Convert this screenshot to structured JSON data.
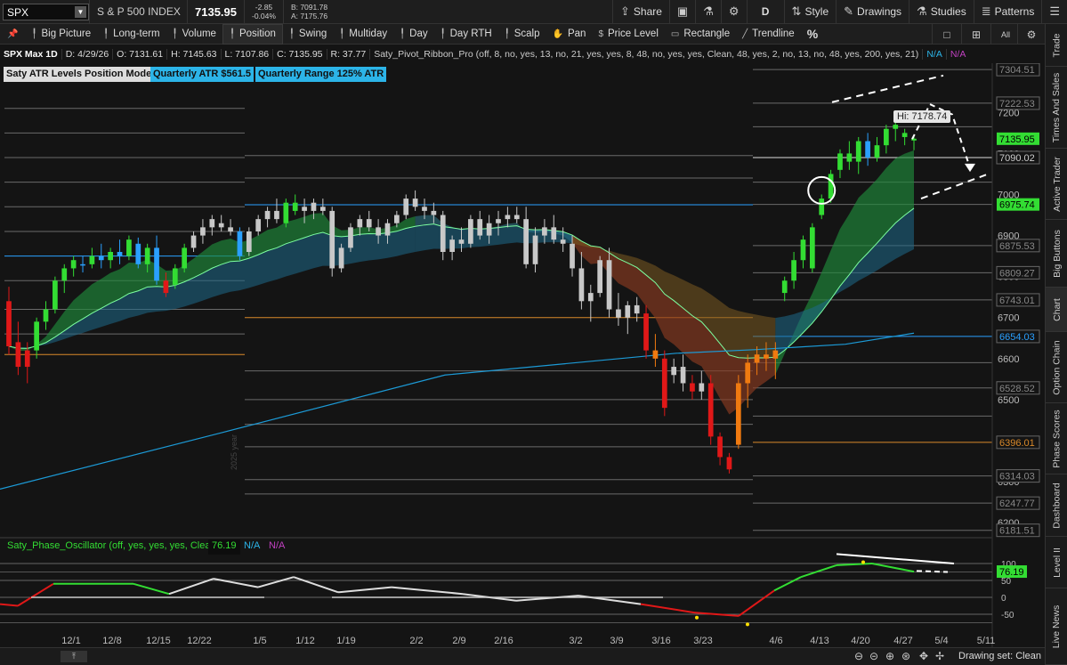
{
  "topbar": {
    "symbol": "SPX",
    "description": "S & P 500 INDEX",
    "last_price": "7135.95",
    "change": "-2.85",
    "change_pct": "-0.04%",
    "bid": "B: 7091.78",
    "ask": "A: 7175.76",
    "share": "Share",
    "aggregation": "D",
    "style": "Style",
    "drawings": "Drawings",
    "studies": "Studies",
    "patterns": "Patterns"
  },
  "toolbar": {
    "items": [
      "Big Picture",
      "Long-term",
      "Volume",
      "Position",
      "Swing",
      "Multiday",
      "Day",
      "Day RTH",
      "Scalp",
      "Pan",
      "Price Level",
      "Rectangle",
      "Trendline"
    ],
    "active": "Position",
    "percent": "%",
    "all_label": "All"
  },
  "infobar": {
    "title": "SPX Max 1D",
    "date": "D: 4/29/26",
    "open": "O: 7131.61",
    "high": "H: 7145.63",
    "low": "L: 7107.86",
    "close": "C: 7135.95",
    "range": "R: 37.77",
    "study": "Saty_Pivot_Ribbon_Pro (off, 8, no, yes, 13, no, 21, yes, yes, 8, 48, no, yes, yes, Clean, 48, yes, 2, no, 13, no, 48, yes, 200, yes, 21)",
    "na1": "N/A",
    "na2": "N/A"
  },
  "badges": {
    "atr_mode": "Saty ATR Levels Position Mode",
    "quarterly_atr": "Quarterly ATR $561.5",
    "quarterly_range": "Quarterly Range 125% ATR"
  },
  "annotations": {
    "hi_label": "Hi: 7178.74",
    "year_watermark": "2025 year"
  },
  "oscillator": {
    "name": "Saty_Phase_Oscillator (off, yes, yes, yes, Clean)",
    "value": "76.19",
    "na1": "N/A",
    "na2": "N/A"
  },
  "sidebar": {
    "tabs": [
      "Trade",
      "Times And Sales",
      "Active Trader",
      "Big Buttons",
      "Chart",
      "Option Chain",
      "Phase Scores",
      "Dashboard",
      "Level II",
      "Live News"
    ]
  },
  "bottombar": {
    "drawing_set": "Drawing set: Clean"
  },
  "colors": {
    "background": "#141414",
    "bull_green": "#33dd33",
    "bull_cyan": "#2aa0ff",
    "bear_red": "#e01818",
    "neutral_gray": "#c8c8c8",
    "ema_blue": "#1c9ad6",
    "atr_orange": "#d9892a",
    "badge_cyan": "#2cb4e8"
  },
  "chart_data": {
    "type": "candlestick",
    "y_axis_labels": [
      "7200",
      "7100",
      "7000",
      "6900",
      "6800",
      "6700",
      "6600",
      "6500",
      "6400",
      "6300",
      "6200"
    ],
    "x_axis_labels": [
      "12/1",
      "12/8",
      "12/15",
      "12/22",
      "1/5",
      "1/12",
      "1/19",
      "2/2",
      "2/9",
      "2/16",
      "3/2",
      "3/9",
      "3/16",
      "3/23",
      "4/6",
      "4/13",
      "4/20",
      "4/27",
      "5/4",
      "5/11"
    ],
    "ylim": [
      6170,
      7320
    ],
    "price_tags": [
      {
        "label": "7304.51",
        "value": 7304.51,
        "color": "#888888"
      },
      {
        "label": "7222.53",
        "value": 7222.53,
        "color": "#888888"
      },
      {
        "label": "7135.95",
        "value": 7135.95,
        "color": "#33dd33"
      },
      {
        "label": "7090.02",
        "value": 7090.02,
        "color": "#cccccc"
      },
      {
        "label": "6975.74",
        "value": 6975.74,
        "color": "#33dd33"
      },
      {
        "label": "6875.53",
        "value": 6875.53,
        "color": "#888888"
      },
      {
        "label": "6809.27",
        "value": 6809.27,
        "color": "#888888"
      },
      {
        "label": "6743.01",
        "value": 6743.01,
        "color": "#888888"
      },
      {
        "label": "6654.03",
        "value": 6654.03,
        "color": "#2aa0ff"
      },
      {
        "label": "6528.52",
        "value": 6528.52,
        "color": "#888888"
      },
      {
        "label": "6396.01",
        "value": 6396.01,
        "color": "#d9892a"
      },
      {
        "label": "6314.03",
        "value": 6314.03,
        "color": "#888888"
      },
      {
        "label": "6247.77",
        "value": 6247.77,
        "color": "#888888"
      },
      {
        "label": "6181.51",
        "value": 6181.51,
        "color": "#888888"
      }
    ],
    "candles": [
      [
        6740,
        6775,
        6610,
        6630,
        "red"
      ],
      [
        6640,
        6690,
        6560,
        6580,
        "red"
      ],
      [
        6580,
        6640,
        6540,
        6620,
        "red"
      ],
      [
        6620,
        6700,
        6600,
        6690,
        "green"
      ],
      [
        6690,
        6740,
        6670,
        6720,
        "green"
      ],
      [
        6720,
        6800,
        6710,
        6790,
        "green"
      ],
      [
        6790,
        6830,
        6760,
        6820,
        "green"
      ],
      [
        6820,
        6850,
        6800,
        6840,
        "green"
      ],
      [
        6830,
        6850,
        6810,
        6830,
        "cyan"
      ],
      [
        6830,
        6870,
        6820,
        6850,
        "green"
      ],
      [
        6850,
        6880,
        6820,
        6840,
        "cyan"
      ],
      [
        6840,
        6870,
        6820,
        6860,
        "green"
      ],
      [
        6860,
        6890,
        6830,
        6850,
        "cyan"
      ],
      [
        6850,
        6900,
        6840,
        6890,
        "green"
      ],
      [
        6880,
        6895,
        6820,
        6830,
        "cyan"
      ],
      [
        6830,
        6880,
        6810,
        6870,
        "green"
      ],
      [
        6870,
        6900,
        6780,
        6790,
        "cyan"
      ],
      [
        6790,
        6810,
        6750,
        6760,
        "red"
      ],
      [
        6780,
        6830,
        6770,
        6820,
        "green"
      ],
      [
        6820,
        6880,
        6810,
        6870,
        "green"
      ],
      [
        6870,
        6910,
        6860,
        6900,
        "gray"
      ],
      [
        6900,
        6940,
        6880,
        6920,
        "gray"
      ],
      [
        6920,
        6950,
        6900,
        6940,
        "gray"
      ],
      [
        6930,
        6950,
        6910,
        6920,
        "gray"
      ],
      [
        6920,
        6940,
        6900,
        6910,
        "gray"
      ],
      [
        6910,
        6920,
        6840,
        6850,
        "cyan"
      ],
      [
        6860,
        6920,
        6850,
        6910,
        "gray"
      ],
      [
        6910,
        6950,
        6900,
        6940,
        "gray"
      ],
      [
        6940,
        6970,
        6920,
        6960,
        "gray"
      ],
      [
        6960,
        6990,
        6930,
        6940,
        "gray"
      ],
      [
        6930,
        6990,
        6920,
        6980,
        "green"
      ],
      [
        6980,
        7000,
        6950,
        6960,
        "green"
      ],
      [
        6960,
        6990,
        6930,
        6970,
        "gray"
      ],
      [
        6960,
        6990,
        6940,
        6980,
        "gray"
      ],
      [
        6970,
        6990,
        6950,
        6960,
        "gray"
      ],
      [
        6960,
        6970,
        6800,
        6820,
        "gray"
      ],
      [
        6820,
        6880,
        6810,
        6870,
        "gray"
      ],
      [
        6870,
        6930,
        6860,
        6920,
        "gray"
      ],
      [
        6920,
        6950,
        6900,
        6940,
        "gray"
      ],
      [
        6940,
        6960,
        6910,
        6920,
        "gray"
      ],
      [
        6920,
        6940,
        6880,
        6900,
        "gray"
      ],
      [
        6900,
        6940,
        6880,
        6930,
        "gray"
      ],
      [
        6930,
        6960,
        6920,
        6950,
        "gray"
      ],
      [
        6950,
        7000,
        6940,
        6990,
        "gray"
      ],
      [
        6990,
        7010,
        6960,
        6970,
        "gray"
      ],
      [
        6970,
        6990,
        6940,
        6960,
        "gray"
      ],
      [
        6960,
        6980,
        6930,
        6950,
        "gray"
      ],
      [
        6950,
        6960,
        6840,
        6860,
        "gray"
      ],
      [
        6860,
        6900,
        6840,
        6890,
        "gray"
      ],
      [
        6890,
        6920,
        6860,
        6880,
        "gray"
      ],
      [
        6880,
        6950,
        6870,
        6940,
        "gray"
      ],
      [
        6940,
        6960,
        6890,
        6900,
        "gray"
      ],
      [
        6900,
        6950,
        6880,
        6930,
        "gray"
      ],
      [
        6930,
        6960,
        6900,
        6940,
        "gray"
      ],
      [
        6940,
        6970,
        6920,
        6950,
        "gray"
      ],
      [
        6950,
        6970,
        6930,
        6940,
        "gray"
      ],
      [
        6940,
        6970,
        6820,
        6830,
        "gray"
      ],
      [
        6830,
        6920,
        6810,
        6900,
        "gray"
      ],
      [
        6900,
        6940,
        6880,
        6920,
        "gray"
      ],
      [
        6920,
        6950,
        6880,
        6890,
        "gray"
      ],
      [
        6890,
        6920,
        6860,
        6880,
        "gray"
      ],
      [
        6880,
        6900,
        6800,
        6820,
        "gray"
      ],
      [
        6820,
        6860,
        6720,
        6740,
        "gray"
      ],
      [
        6740,
        6780,
        6690,
        6760,
        "gray"
      ],
      [
        6760,
        6850,
        6750,
        6840,
        "gray"
      ],
      [
        6840,
        6870,
        6700,
        6720,
        "gray"
      ],
      [
        6720,
        6760,
        6680,
        6700,
        "gray"
      ],
      [
        6700,
        6740,
        6660,
        6730,
        "gray"
      ],
      [
        6730,
        6750,
        6690,
        6710,
        "gray"
      ],
      [
        6710,
        6730,
        6600,
        6620,
        "red"
      ],
      [
        6620,
        6660,
        6580,
        6600,
        "orange"
      ],
      [
        6600,
        6620,
        6460,
        6480,
        "red"
      ],
      [
        6560,
        6600,
        6540,
        6580,
        "gray"
      ],
      [
        6580,
        6610,
        6520,
        6540,
        "gray"
      ],
      [
        6540,
        6560,
        6500,
        6520,
        "red"
      ],
      [
        6520,
        6570,
        6500,
        6540,
        "gray"
      ],
      [
        6540,
        6560,
        6390,
        6410,
        "red"
      ],
      [
        6410,
        6420,
        6340,
        6360,
        "red"
      ],
      [
        6360,
        6370,
        6320,
        6330,
        "red"
      ],
      [
        6390,
        6560,
        6380,
        6540,
        "orange"
      ],
      [
        6540,
        6610,
        6480,
        6590,
        "orange"
      ],
      [
        6590,
        6630,
        6560,
        6610,
        "orange"
      ],
      [
        6610,
        6640,
        6570,
        6600,
        "orange"
      ],
      [
        6600,
        6640,
        6550,
        6620,
        "orange"
      ],
      [
        6760,
        6800,
        6740,
        6790,
        "green"
      ],
      [
        6790,
        6860,
        6770,
        6840,
        "green"
      ],
      [
        6840,
        6900,
        6820,
        6890,
        "green"
      ],
      [
        6820,
        6930,
        6810,
        6920,
        "green"
      ],
      [
        6950,
        7000,
        6940,
        6990,
        "green"
      ],
      [
        6990,
        7060,
        6980,
        7050,
        "green"
      ],
      [
        7060,
        7110,
        7040,
        7100,
        "green"
      ],
      [
        7100,
        7130,
        7060,
        7080,
        "green"
      ],
      [
        7080,
        7140,
        7050,
        7130,
        "green"
      ],
      [
        7130,
        7150,
        7070,
        7090,
        "cyan"
      ],
      [
        7090,
        7140,
        7080,
        7120,
        "green"
      ],
      [
        7120,
        7170,
        7100,
        7160,
        "green"
      ],
      [
        7160,
        7180,
        7130,
        7170,
        "green"
      ],
      [
        7150,
        7160,
        7120,
        7140,
        "green"
      ],
      [
        7131.61,
        7145.63,
        7107.86,
        7135.95,
        "green"
      ]
    ],
    "ema200": [
      [
        0,
        6282
      ],
      [
        250,
        6420
      ],
      [
        500,
        6560
      ],
      [
        760,
        6613
      ],
      [
        850,
        6622
      ],
      [
        950,
        6635
      ],
      [
        1027,
        6662
      ]
    ],
    "osc_levels": [
      100,
      50,
      0,
      -50
    ],
    "oscillator": [
      [
        0,
        -20
      ],
      [
        20,
        -25
      ],
      [
        60,
        40
      ],
      [
        150,
        40
      ],
      [
        190,
        10
      ],
      [
        240,
        55
      ],
      [
        290,
        30
      ],
      [
        330,
        60
      ],
      [
        380,
        15
      ],
      [
        440,
        30
      ],
      [
        520,
        10
      ],
      [
        580,
        -10
      ],
      [
        650,
        5
      ],
      [
        720,
        -20
      ],
      [
        780,
        -45
      ],
      [
        830,
        -55
      ],
      [
        870,
        20
      ],
      [
        900,
        60
      ],
      [
        940,
        95
      ],
      [
        980,
        100
      ],
      [
        1027,
        76
      ]
    ]
  }
}
